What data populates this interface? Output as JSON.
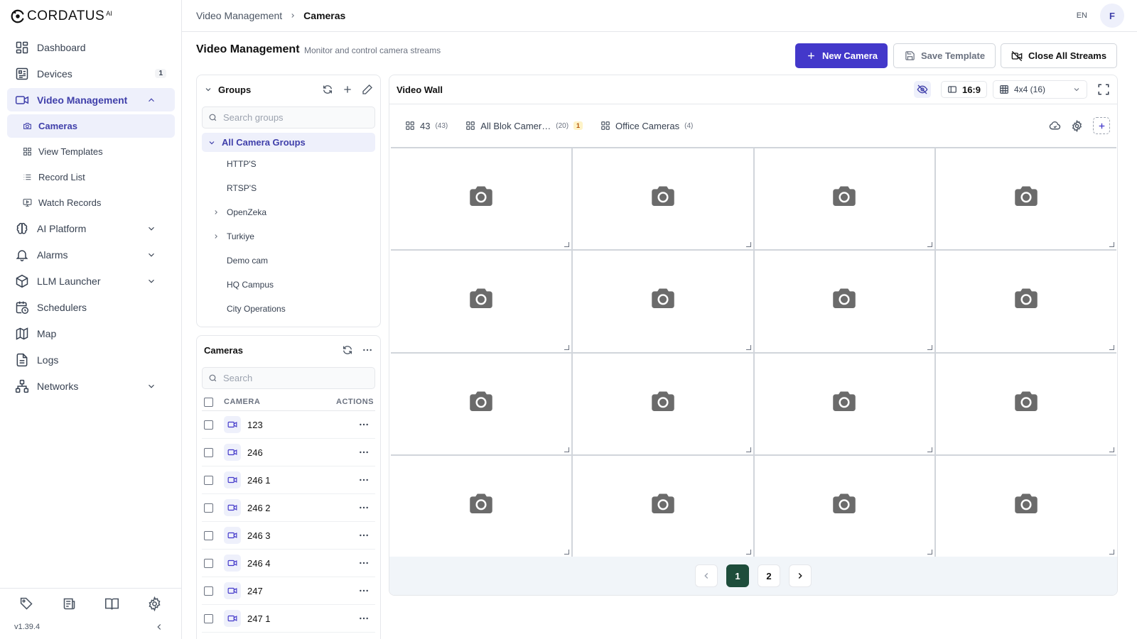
{
  "app": {
    "logo_text": "CORDATUS",
    "logo_sup": "AI",
    "version": "v1.39.4"
  },
  "sidebar": {
    "items": [
      {
        "label": "Dashboard",
        "icon": "dashboard-icon"
      },
      {
        "label": "Devices",
        "icon": "devices-icon",
        "badge": "1"
      },
      {
        "label": "Video Management",
        "icon": "video-icon",
        "expanded": true
      },
      {
        "label": "AI Platform",
        "icon": "brain-icon"
      },
      {
        "label": "Alarms",
        "icon": "bell-icon"
      },
      {
        "label": "LLM Launcher",
        "icon": "cube-icon"
      },
      {
        "label": "Schedulers",
        "icon": "calendar-clock-icon"
      },
      {
        "label": "Map",
        "icon": "map-icon"
      },
      {
        "label": "Logs",
        "icon": "file-icon"
      },
      {
        "label": "Networks",
        "icon": "network-icon"
      }
    ],
    "sub_items": [
      {
        "label": "Cameras",
        "icon": "camera-icon",
        "active": true
      },
      {
        "label": "View Templates",
        "icon": "grid-icon"
      },
      {
        "label": "Record List",
        "icon": "list-icon"
      },
      {
        "label": "Watch Records",
        "icon": "monitor-play-icon"
      }
    ]
  },
  "topbar": {
    "breadcrumb_parent": "Video Management",
    "breadcrumb_current": "Cameras",
    "lang": "EN",
    "avatar_initial": "F"
  },
  "page": {
    "title": "Video Management",
    "subtitle": "Monitor and control camera streams",
    "btn_new_camera": "New Camera",
    "btn_save_template": "Save Template",
    "btn_close_streams": "Close All Streams"
  },
  "groups": {
    "title": "Groups",
    "search_placeholder": "Search groups",
    "root": "All Camera Groups",
    "items": [
      {
        "label": "HTTP'S",
        "has_children": false
      },
      {
        "label": "RTSP'S",
        "has_children": false
      },
      {
        "label": "OpenZeka",
        "has_children": true
      },
      {
        "label": "Turkiye",
        "has_children": true
      },
      {
        "label": "Demo cam",
        "has_children": false
      },
      {
        "label": "HQ Campus",
        "has_children": false
      },
      {
        "label": "City Operations",
        "has_children": false
      }
    ]
  },
  "cameras": {
    "title": "Cameras",
    "search_placeholder": "Search",
    "col_camera": "CAMERA",
    "col_actions": "ACTIONS",
    "rows": [
      "123",
      "246",
      "246 1",
      "246 2",
      "246 3",
      "246 4",
      "247",
      "247 1"
    ]
  },
  "video_wall": {
    "title": "Video Wall",
    "aspect": "16:9",
    "layout": "4x4 (16)",
    "tabs": [
      {
        "label": "43",
        "count": "(43)",
        "badge": ""
      },
      {
        "label": "All Blok Camer…",
        "count": "(20)",
        "badge": "1"
      },
      {
        "label": "Office Cameras",
        "count": "(4)",
        "badge": ""
      }
    ],
    "cell_count": 16,
    "pages": [
      "1",
      "2"
    ],
    "active_page": "1"
  },
  "colors": {
    "accent": "#4338ca",
    "active_bg": "#eef0fb",
    "pager_active": "#1e4d3b"
  }
}
